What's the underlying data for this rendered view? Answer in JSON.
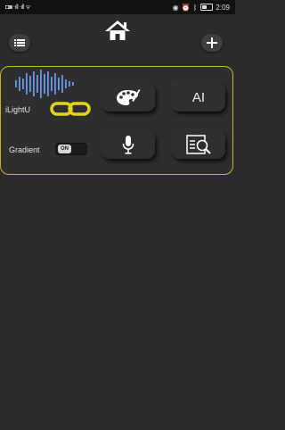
{
  "status_bar": {
    "left_glyphs": "◘◙ ‧ıll ‧ıll ᯤ",
    "time": "2:09",
    "icons": [
      "eye-icon",
      "alarm-icon",
      "bluetooth-icon",
      "battery-icon"
    ]
  },
  "header": {
    "home_icon": "home-icon",
    "menu_icon": "list-icon",
    "add_icon": "plus-icon"
  },
  "device_panel": {
    "app_name": "iLightU",
    "gradient_label": "Gradient",
    "gradient_toggle_text": "ON",
    "border_color": "#c9b428",
    "link_color": "#e5d21b",
    "tiles": [
      {
        "name": "palette",
        "icon": "palette-icon"
      },
      {
        "name": "ai",
        "label": "AI"
      },
      {
        "name": "microphone",
        "icon": "microphone-icon"
      },
      {
        "name": "scan",
        "icon": "scan-search-icon"
      }
    ]
  }
}
